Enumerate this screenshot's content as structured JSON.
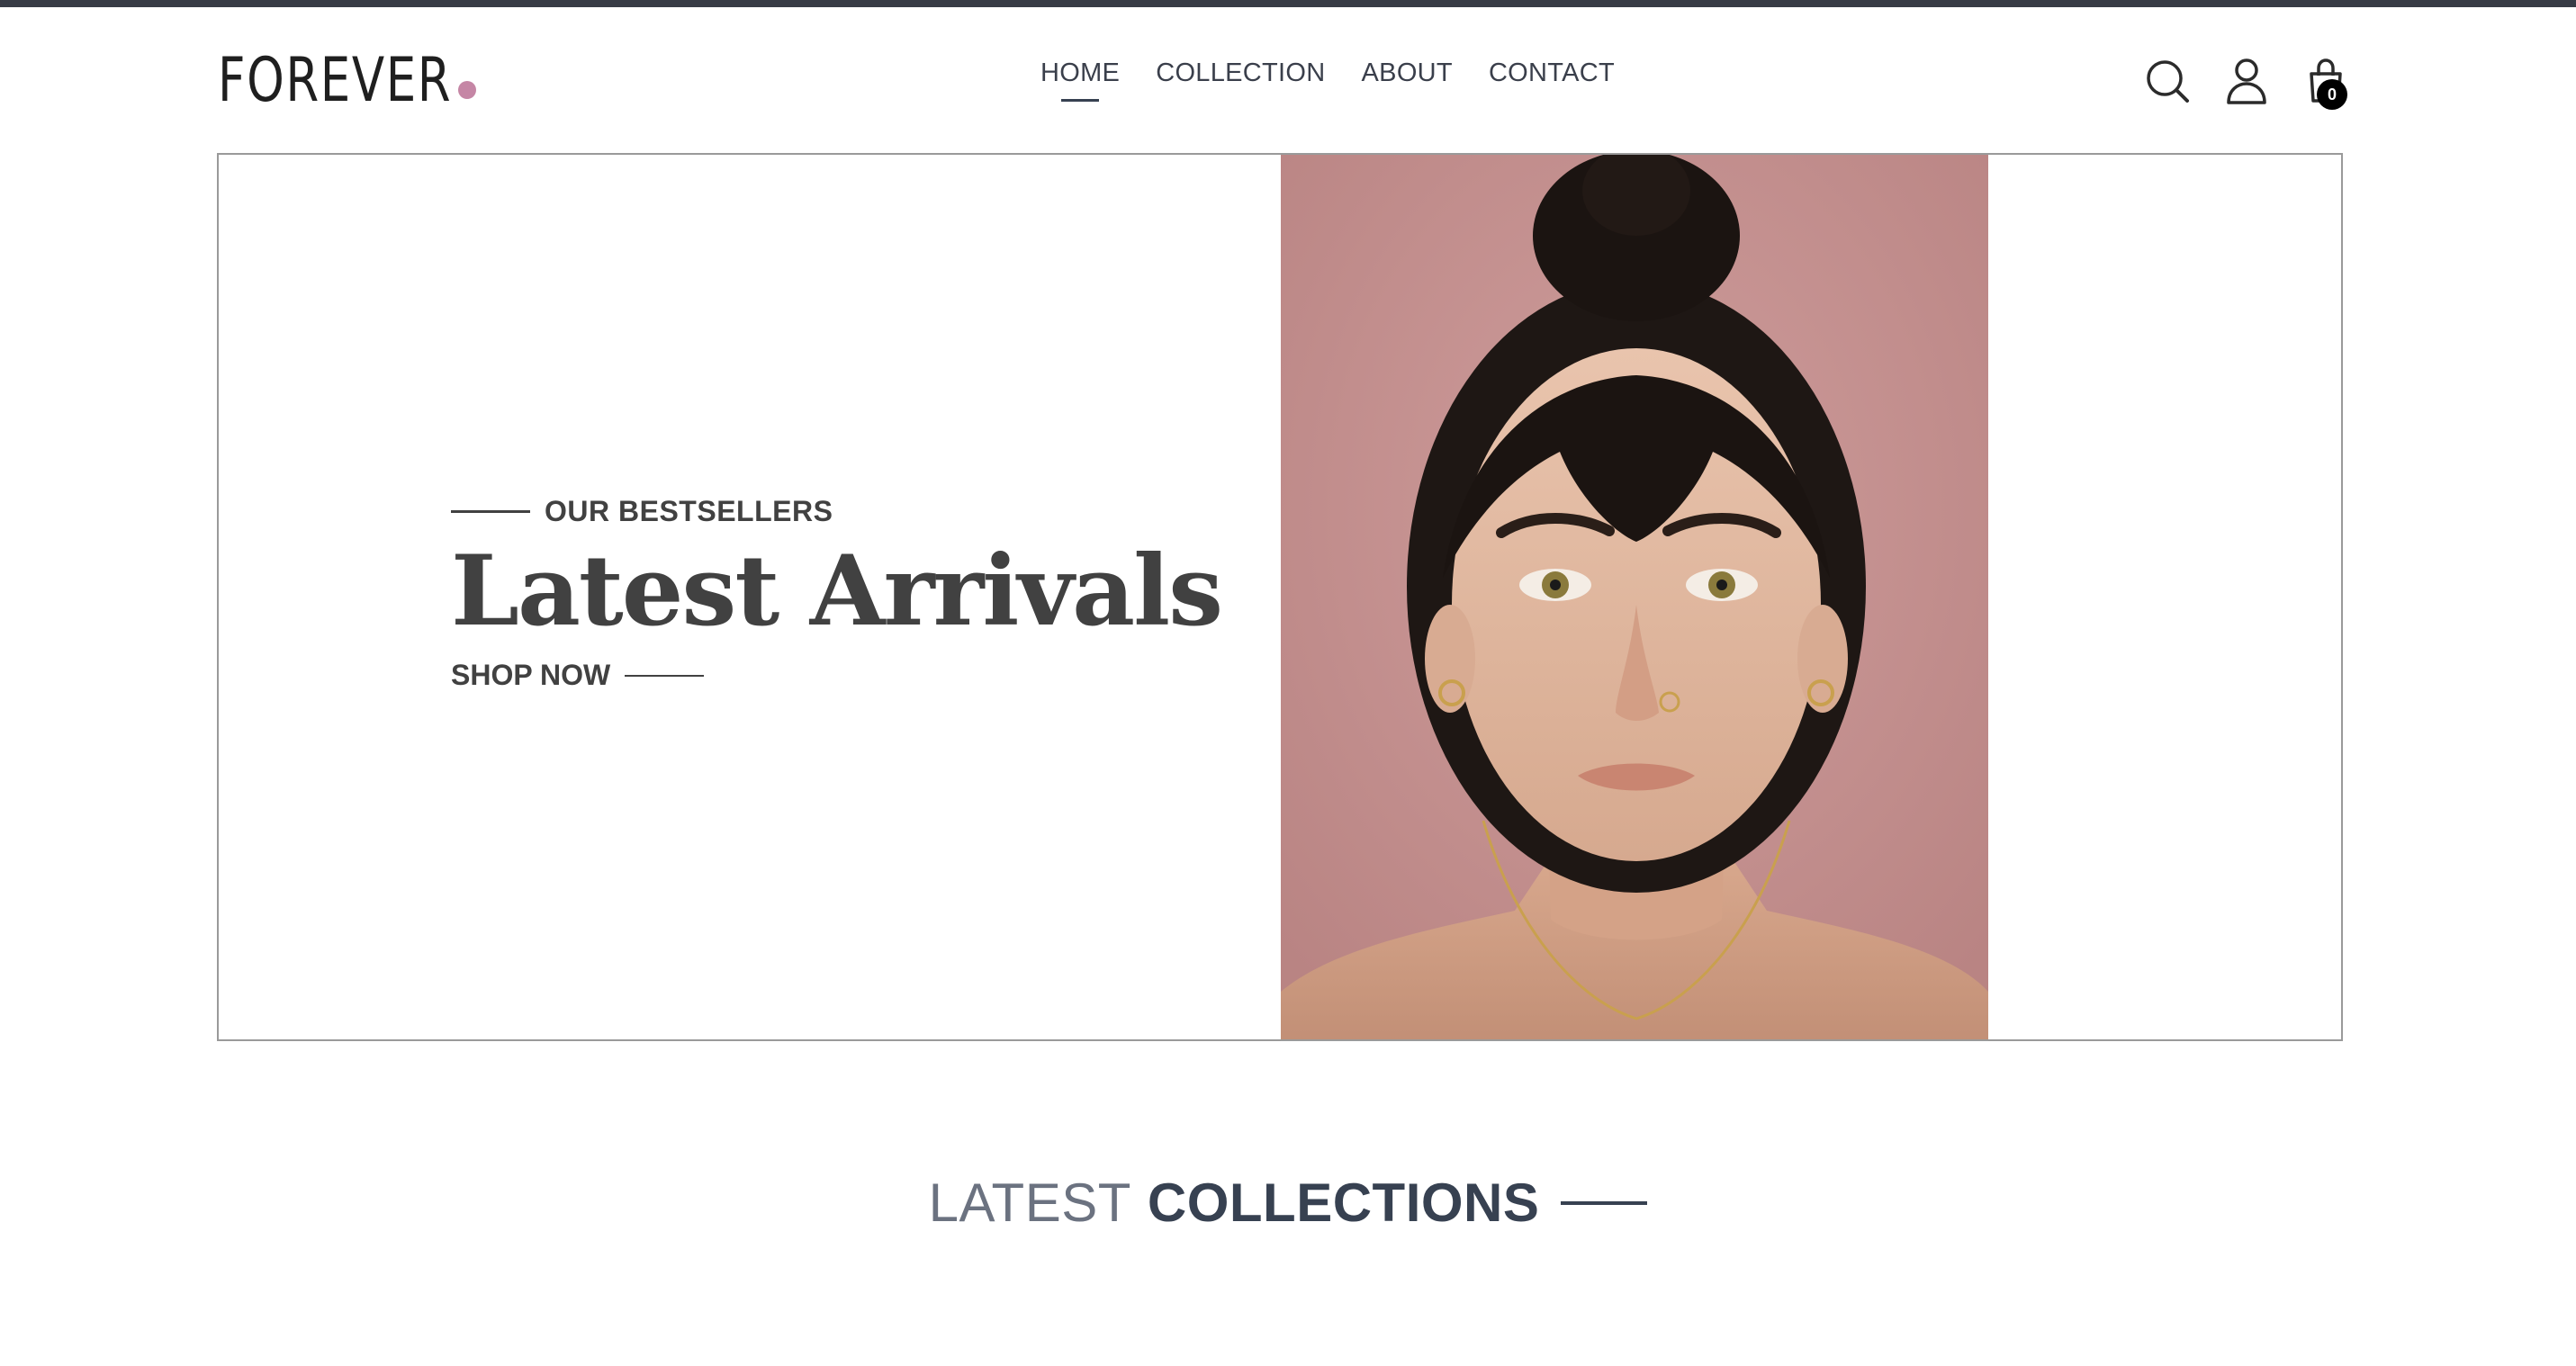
{
  "brand": {
    "logo_text": "FOREVER",
    "accent": "#c586a5"
  },
  "nav": {
    "items": [
      {
        "label": "HOME",
        "active": true
      },
      {
        "label": "COLLECTION",
        "active": false
      },
      {
        "label": "ABOUT",
        "active": false
      },
      {
        "label": "CONTACT",
        "active": false
      }
    ]
  },
  "header_icons": {
    "search": "search-icon",
    "profile": "profile-icon",
    "cart": "cart-icon",
    "cart_count": "0"
  },
  "hero": {
    "eyebrow": "OUR BESTSELLERS",
    "title": "Latest Arrivals",
    "cta": "SHOP NOW",
    "image_bg": "#c4908f"
  },
  "section": {
    "title_part1": "LATEST",
    "title_part2": "COLLECTIONS"
  },
  "colors": {
    "topbar": "#373b45",
    "text_dark": "#374151",
    "text_muted": "#6b7280"
  }
}
